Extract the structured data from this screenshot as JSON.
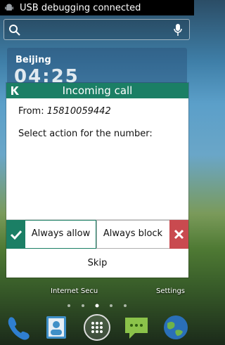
{
  "status_bar": {
    "text": "USB debugging connected"
  },
  "search": {
    "placeholder": ""
  },
  "clock_widget": {
    "city": "Beijing",
    "time": "04:25"
  },
  "home": {
    "internet_label": "Internet Secu",
    "settings_label": "Settings"
  },
  "dialog": {
    "title": "Incoming call",
    "from_label": "From:",
    "from_number": "15810059442",
    "prompt": "Select action for the number:",
    "allow_label": "Always allow",
    "block_label": "Always block",
    "skip_label": "Skip"
  },
  "colors": {
    "accent": "#1b7f65",
    "block": "#c94a4f"
  },
  "icons": [
    "android-icon",
    "search-icon",
    "mic-icon",
    "kaspersky-logo-icon",
    "check-icon",
    "close-icon",
    "phone-icon",
    "contacts-icon",
    "apps-icon",
    "messaging-icon",
    "browser-icon"
  ]
}
